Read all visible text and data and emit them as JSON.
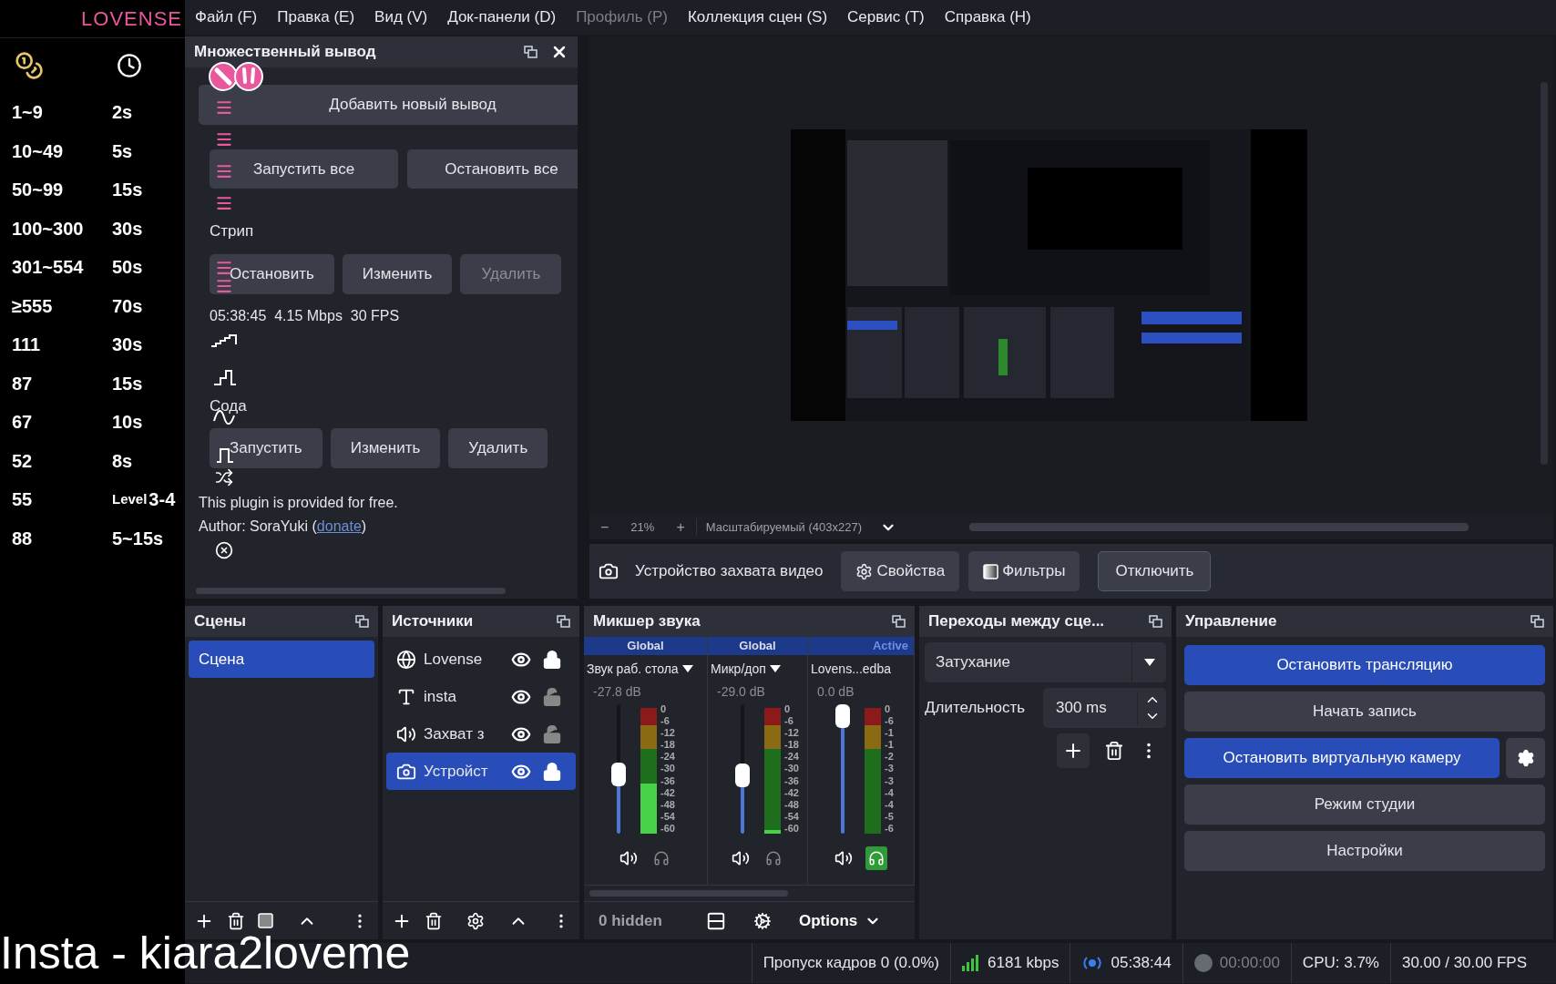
{
  "lovense_panel": {
    "logo": "LOVENSE",
    "rows": [
      {
        "tokens": "1~9",
        "time": "2s"
      },
      {
        "tokens": "10~49",
        "time": "5s"
      },
      {
        "tokens": "50~99",
        "time": "15s"
      },
      {
        "tokens": "100~300",
        "time": "30s"
      },
      {
        "tokens": "301~554",
        "time": "50s"
      },
      {
        "tokens": "≥555",
        "time": "70s"
      },
      {
        "tokens": "111",
        "time": "30s"
      },
      {
        "tokens": "87",
        "time": "15s"
      },
      {
        "tokens": "67",
        "time": "10s"
      },
      {
        "tokens": "52",
        "time": "8s"
      },
      {
        "tokens": "55",
        "time_prefix": "Level",
        "time": "3-4"
      },
      {
        "tokens": "88",
        "time": "5~15s"
      }
    ]
  },
  "menu": [
    {
      "label": "Файл (F)",
      "disabled": false
    },
    {
      "label": "Правка (E)",
      "disabled": false
    },
    {
      "label": "Вид (V)",
      "disabled": false
    },
    {
      "label": "Док-панели (D)",
      "disabled": false
    },
    {
      "label": "Профиль (P)",
      "disabled": true
    },
    {
      "label": "Коллекция сцен (S)",
      "disabled": false
    },
    {
      "label": "Сервис (T)",
      "disabled": false
    },
    {
      "label": "Справка (H)",
      "disabled": false
    }
  ],
  "multiple_output": {
    "title": "Множественный вывод",
    "add_button": "Добавить новый вывод",
    "start_all": "Запустить все",
    "stop_all": "Остановить все",
    "outputs": [
      {
        "name": "Стрип",
        "status": "05:38:45  4.15 Mbps  30 FPS",
        "buttons": [
          {
            "label": "Остановить",
            "disabled": false
          },
          {
            "label": "Изменить",
            "disabled": false
          },
          {
            "label": "Удалить",
            "disabled": true
          }
        ]
      },
      {
        "name": "Сода",
        "buttons": [
          {
            "label": "Запустить",
            "disabled": false
          },
          {
            "label": "Изменить",
            "disabled": false
          },
          {
            "label": "Удалить",
            "disabled": false
          }
        ]
      }
    ],
    "footer": "This plugin is provided for free.",
    "author_prefix": "Author: SoraYuki (",
    "link": "donate",
    "author_suffix": ")"
  },
  "preview": {
    "zoom_minus": "−",
    "zoom": "21%",
    "zoom_plus": "+",
    "scale_mode": "Масштабируемый (403x227)"
  },
  "source_toolbar": {
    "source": "Устройство захвата видео",
    "buttons": [
      {
        "label": "Свойства",
        "kind": "properties"
      },
      {
        "label": "Фильтры",
        "kind": "filters"
      },
      {
        "label": "Отключить",
        "kind": "plain"
      }
    ]
  },
  "scenes": {
    "title": "Сцены",
    "items": [
      {
        "name": "Сцена",
        "selected": true
      }
    ]
  },
  "sources": {
    "title": "Источники",
    "items": [
      {
        "name": "Lovense",
        "kind": "browser",
        "visible": true,
        "locked": true,
        "selected": false
      },
      {
        "name": "insta",
        "kind": "text",
        "visible": true,
        "locked": false,
        "selected": false
      },
      {
        "name": "Захват з",
        "kind": "audio",
        "visible": true,
        "locked": false,
        "selected": false
      },
      {
        "name": "Устройст",
        "kind": "camera",
        "visible": true,
        "locked": true,
        "selected": true
      }
    ]
  },
  "mixer": {
    "title": "Микшер звука",
    "hidden": "0 hidden",
    "options": "Options",
    "channels": [
      {
        "mode": "Global",
        "mode_active": false,
        "name": "Звук раб. стола",
        "has_menu": true,
        "reading": "-27.8 dB",
        "level": 0.45,
        "meter": {
          "level": 0.4
        },
        "monitoring": false,
        "ticks": [
          "0",
          "-6",
          "-12",
          "-18",
          "-24",
          "-30",
          "-36",
          "-42",
          "-48",
          "-54",
          "-60"
        ]
      },
      {
        "mode": "Global",
        "mode_active": false,
        "name": "Микр/доп",
        "has_menu": true,
        "reading": "-29.0 dB",
        "level": 0.44,
        "meter": {
          "level": 0.03
        },
        "monitoring": false,
        "ticks": [
          "0",
          "-6",
          "-12",
          "-18",
          "-24",
          "-30",
          "-36",
          "-42",
          "-48",
          "-54",
          "-60"
        ]
      },
      {
        "mode": "Active",
        "mode_active": true,
        "name": "Lovens...edba",
        "has_menu": false,
        "reading": "0.0 dB",
        "level": 1,
        "monitoring": true,
        "ticks": [
          "0",
          "-6",
          "-1",
          "-1",
          "-2",
          "-3",
          "-3",
          "-4",
          "-4",
          "-5",
          "-6"
        ]
      }
    ]
  },
  "transitions": {
    "title": "Переходы между сце...",
    "transition": "Затухание",
    "duration_label": "Длительность",
    "duration": "300 ms"
  },
  "controls": {
    "title": "Управление",
    "buttons": [
      {
        "label": "Остановить трансляцию",
        "active": true,
        "has_settings": false
      },
      {
        "label": "Начать запись",
        "active": false,
        "has_settings": false
      },
      {
        "label": "Остановить виртуальную камеру",
        "active": true,
        "has_settings": true
      },
      {
        "label": "Режим студии",
        "active": false,
        "has_settings": false
      },
      {
        "label": "Настройки",
        "active": false,
        "has_settings": false
      }
    ]
  },
  "status_bar": {
    "dropped": "Пропуск кадров 0 (0.0%)",
    "bitrate": "6181 kbps",
    "streaming": true,
    "stream_time": "05:38:44",
    "recording": false,
    "record_time": "00:00:00",
    "cpu": "CPU: 3.7%",
    "fps": "30.00 / 30.00 FPS"
  },
  "overlay_caption": "Insta - kiara2loveme"
}
